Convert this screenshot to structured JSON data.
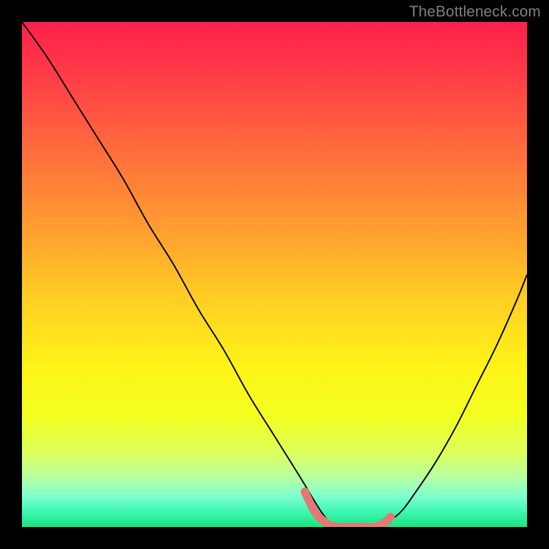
{
  "watermark": "TheBottleneck.com",
  "chart_data": {
    "type": "line",
    "title": "",
    "xlabel": "",
    "ylabel": "",
    "xlim": [
      0,
      100
    ],
    "ylim": [
      0,
      100
    ],
    "grid": false,
    "legend": false,
    "gradient_stops": [
      {
        "offset": 0.0,
        "color": "#ff1f4b"
      },
      {
        "offset": 0.1,
        "color": "#ff3a47"
      },
      {
        "offset": 0.25,
        "color": "#ff6b3d"
      },
      {
        "offset": 0.4,
        "color": "#ff9a31"
      },
      {
        "offset": 0.55,
        "color": "#ffcf23"
      },
      {
        "offset": 0.68,
        "color": "#fff317"
      },
      {
        "offset": 0.78,
        "color": "#f2ff1f"
      },
      {
        "offset": 0.85,
        "color": "#ddff59"
      },
      {
        "offset": 0.9,
        "color": "#b9ffa0"
      },
      {
        "offset": 0.94,
        "color": "#7dffd0"
      },
      {
        "offset": 0.97,
        "color": "#3cf7b2"
      },
      {
        "offset": 1.0,
        "color": "#1de27b"
      }
    ],
    "series": [
      {
        "name": "bottleneck-curve",
        "stroke": "#000000",
        "x": [
          0,
          5,
          10,
          15,
          20,
          25,
          30,
          35,
          40,
          45,
          50,
          55,
          58,
          60,
          62,
          65,
          68,
          72,
          75,
          78,
          82,
          86,
          90,
          94,
          98,
          100
        ],
        "y": [
          100,
          93,
          85,
          77,
          69,
          60,
          52,
          43,
          35,
          26,
          18,
          10,
          5,
          2,
          0,
          0,
          0,
          1,
          3,
          7,
          13,
          20,
          28,
          36,
          45,
          50
        ]
      },
      {
        "name": "highlight-band",
        "stroke": "#e37875",
        "stroke_width": 12,
        "x": [
          56,
          58,
          60,
          62,
          65,
          68,
          70,
          72,
          73
        ],
        "y": [
          7,
          3,
          1,
          0,
          0,
          0,
          0,
          1,
          2
        ]
      }
    ]
  }
}
